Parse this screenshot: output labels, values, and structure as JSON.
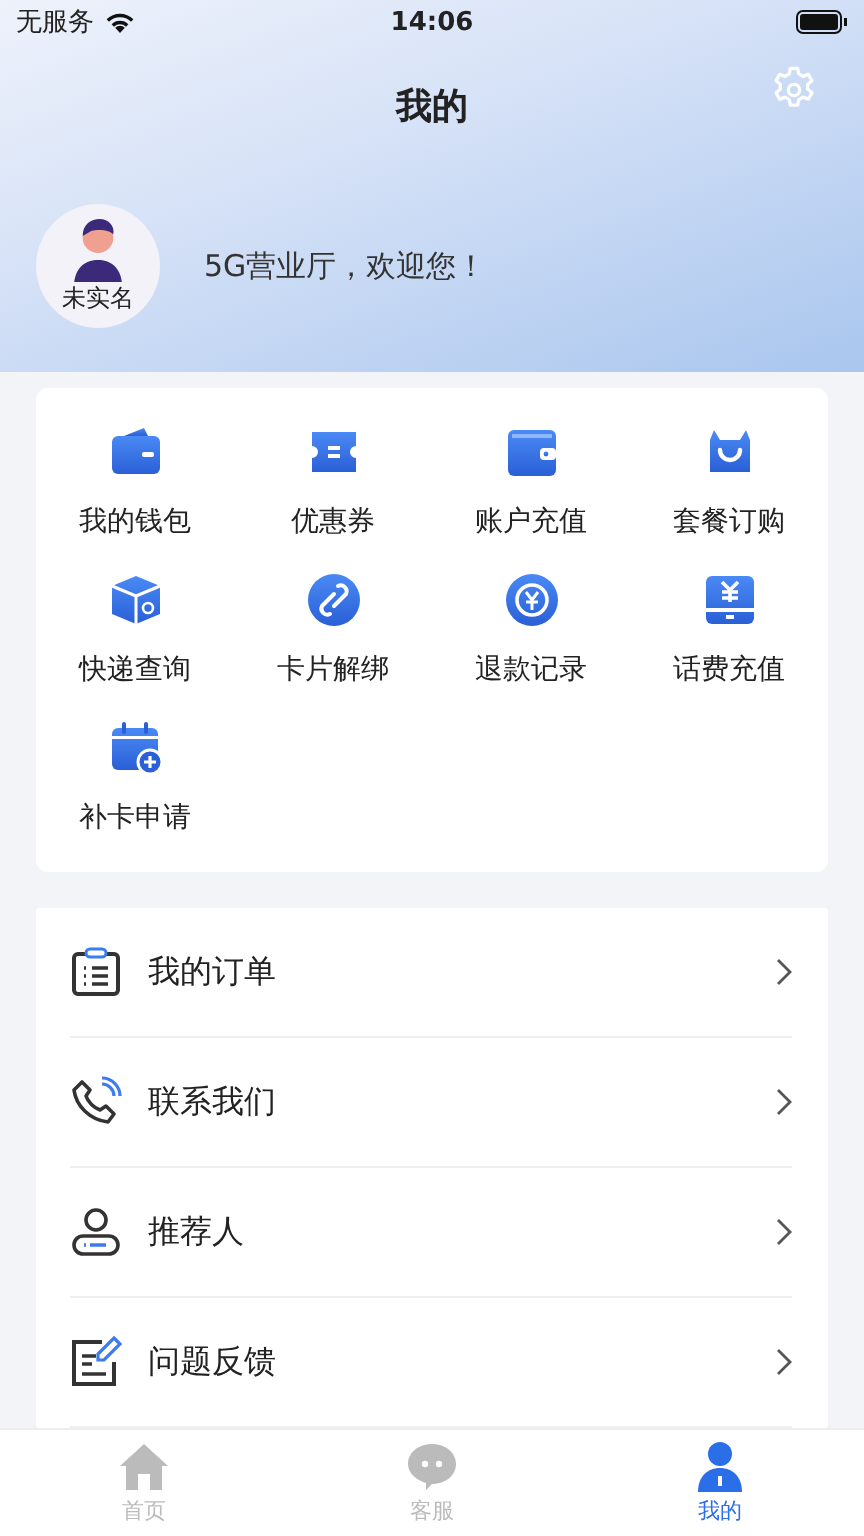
{
  "status_bar": {
    "carrier": "无服务",
    "time": "14:06"
  },
  "header": {
    "title": "我的"
  },
  "profile": {
    "name_tag": "未实名",
    "greeting": "5G营业厅，欢迎您！"
  },
  "services": [
    {
      "label": "我的钱包"
    },
    {
      "label": "优惠券"
    },
    {
      "label": "账户充值"
    },
    {
      "label": "套餐订购"
    },
    {
      "label": "快递查询"
    },
    {
      "label": "卡片解绑"
    },
    {
      "label": "退款记录"
    },
    {
      "label": "话费充值"
    },
    {
      "label": "补卡申请"
    }
  ],
  "menu": [
    {
      "label": "我的订单"
    },
    {
      "label": "联系我们"
    },
    {
      "label": "推荐人"
    },
    {
      "label": "问题反馈"
    }
  ],
  "tab_bar": [
    {
      "label": "首页",
      "selected": false
    },
    {
      "label": "客服",
      "selected": false
    },
    {
      "label": "我的",
      "selected": true
    }
  ]
}
